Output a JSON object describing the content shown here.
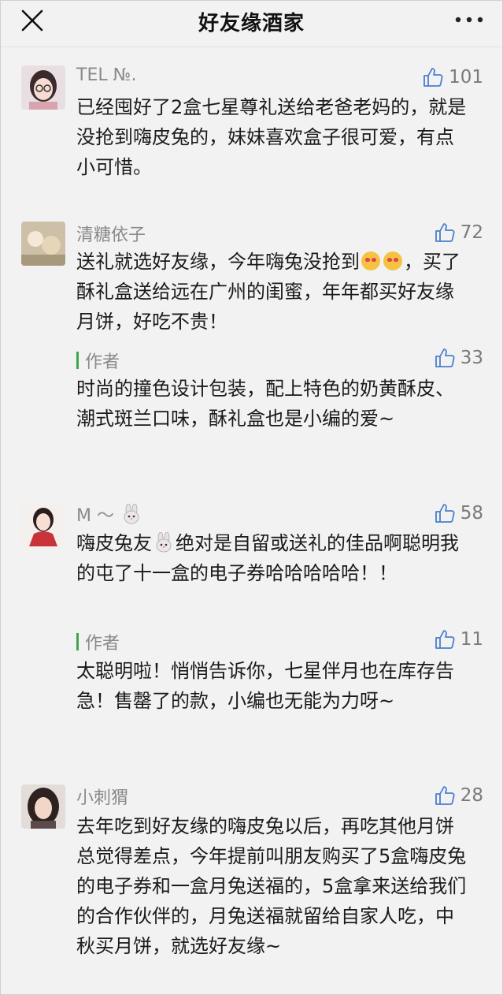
{
  "header": {
    "title": "好友缘酒家",
    "close_icon": "close-icon",
    "more_icon": "more-icon"
  },
  "comments": [
    {
      "nick": "TEL №.",
      "likes": "101",
      "text": "已经囤好了2盒七星尊礼送给老爸老妈的，就是没抢到嗨皮兔的，妹妹喜欢盒子很可爱，有点小可惜。"
    },
    {
      "nick": "清糖依子",
      "likes": "72",
      "text_before_emoji": "送礼就选好友缘，今年嗨兔没抢到",
      "text_after_emoji": "，买了酥礼盒送给远在广州的闺蜜，年年都买好友缘月饼，好吃不贵！",
      "emoji": "heart-eyes-emoji",
      "reply": {
        "label": "作者",
        "likes": "33",
        "text": "时尚的撞色设计包装，配上特色的奶黄酥皮、潮式斑兰口味，酥礼盒也是小编的爱~"
      }
    },
    {
      "nick": "M ～",
      "nick_icon": "rabbit-emoji",
      "likes": "58",
      "text_before_icon": "嗨皮兔友",
      "text_after_icon": "绝对是自留或送礼的佳品啊聪明我的屯了十一盒的电子券哈哈哈哈哈！！",
      "reply": {
        "label": "作者",
        "likes": "11",
        "text": "太聪明啦！悄悄告诉你，七星伴月也在库存告急！售罄了的款，小编也无能为力呀~"
      }
    },
    {
      "nick": "小刺猬",
      "likes": "28",
      "text": "去年吃到好友缘的嗨皮兔以后，再吃其他月饼总觉得差点，今年提前叫朋友购买了5盒嗨皮兔的电子券和一盒月兔送福的，5盒拿来送给我们的合作伙伴的，月兔送福就留给自家人吃，中秋买月饼，就选好友缘~"
    }
  ],
  "colors": {
    "accent_green": "#3fa44b",
    "meta_gray": "#8a8a8a",
    "background": "#f2f2f2"
  }
}
